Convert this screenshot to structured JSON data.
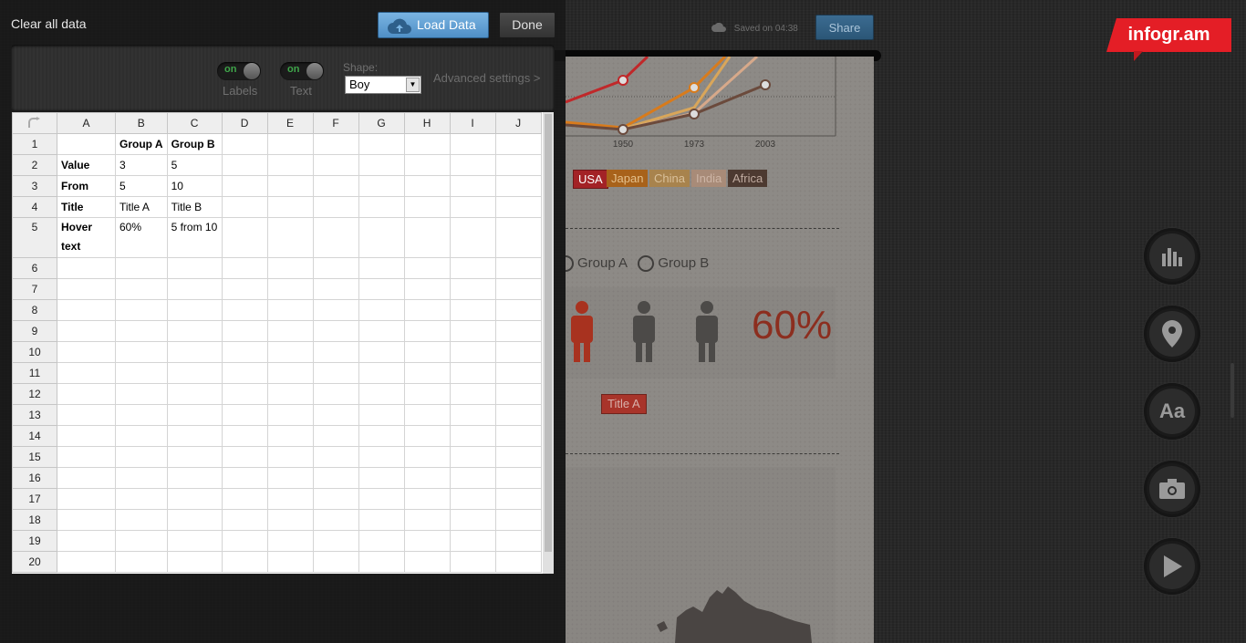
{
  "app": {
    "saved_text": "Saved on 04:38",
    "share_label": "Share",
    "logo_text": "infogr.am"
  },
  "canvas": {
    "chart_years": [
      "1950",
      "1973",
      "2003"
    ],
    "legend": [
      {
        "label": "USA",
        "color": "#c0282a"
      },
      {
        "label": "Japan",
        "color": "#d87b1c"
      },
      {
        "label": "China",
        "color": "#d9a65a"
      },
      {
        "label": "India",
        "color": "#d7a98a"
      },
      {
        "label": "Africa",
        "color": "#6b4a3c"
      }
    ],
    "radio_a": "Group A",
    "radio_b": "Group B",
    "percent": "60%",
    "title_chip": "Title A"
  },
  "tools": [
    "bar-chart-icon",
    "map-pin-icon",
    "text-icon",
    "camera-icon",
    "play-icon"
  ],
  "editor": {
    "clear_label": "Clear all data",
    "load_label": "Load Data",
    "done_label": "Done",
    "labels_toggle": {
      "state": "on",
      "label": "Labels"
    },
    "text_toggle": {
      "state": "on",
      "label": "Text"
    },
    "shape_label": "Shape:",
    "shape_value": "Boy",
    "advanced_label": "Advanced settings >"
  },
  "sheet": {
    "columns": [
      "A",
      "B",
      "C",
      "D",
      "E",
      "F",
      "G",
      "H",
      "I",
      "J"
    ],
    "row_numbers": [
      "1",
      "2",
      "3",
      "4",
      "5",
      "6",
      "7",
      "8",
      "9",
      "10",
      "11",
      "12",
      "13",
      "14",
      "15",
      "16",
      "17",
      "18",
      "19",
      "20"
    ],
    "cells": {
      "r1": [
        "",
        "Group A",
        "Group B"
      ],
      "r2": [
        "Value",
        "3",
        "5"
      ],
      "r3": [
        "From",
        "5",
        "10"
      ],
      "r4": [
        "Title",
        "Title A",
        "Title B"
      ],
      "r5": [
        "Hover text",
        "60%",
        "5 from 10"
      ]
    }
  }
}
